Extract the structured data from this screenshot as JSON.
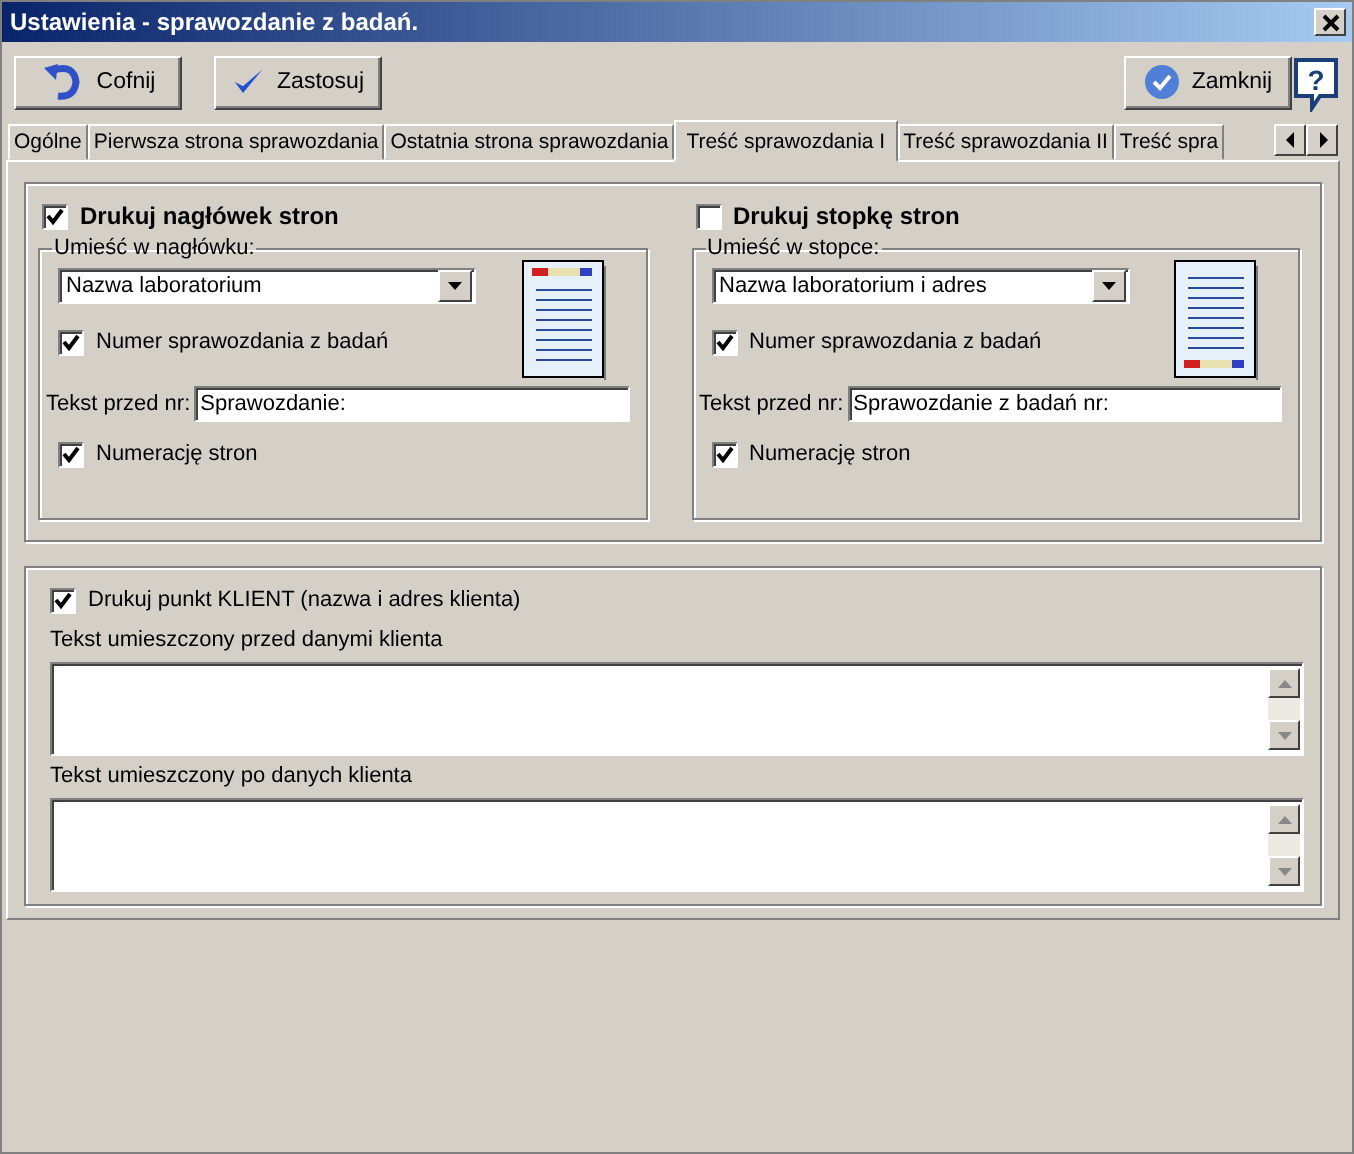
{
  "window": {
    "title": "Ustawienia - sprawozdanie z badań."
  },
  "toolbar": [
    {
      "kind": "undo",
      "label": "Cofnij"
    },
    {
      "kind": "apply",
      "label": "Zastosuj"
    }
  ],
  "close_button": {
    "label": "Zamknij"
  },
  "help_button": {
    "label": "?"
  },
  "tabs": [
    {
      "label": "Ogólne",
      "selected": false
    },
    {
      "label": "Pierwsza strona sprawozdania",
      "selected": false
    },
    {
      "label": "Ostatnia strona sprawozdania",
      "selected": false
    },
    {
      "label": "Treść sprawozdania I",
      "selected": true
    },
    {
      "label": "Treść sprawozdania II",
      "selected": false
    },
    {
      "label": "Treść spra",
      "selected": false
    }
  ],
  "sections": [
    {
      "print_label": "Drukuj nagłówek stron",
      "checked": true,
      "group_label": "Umieść w nagłówku:",
      "kind": "header",
      "dropdown": "Nazwa laboratorium",
      "number_option": {
        "label": "Numer sprawozdania z badań",
        "checked": true
      },
      "prefix_label": "Tekst przed nr:",
      "prefix_value": "Sprawozdanie:",
      "pages_option": {
        "label": "Numerację stron",
        "checked": true
      }
    },
    {
      "print_label": "Drukuj stopkę stron",
      "checked": false,
      "group_label": "Umieść w stopce:",
      "kind": "footer",
      "dropdown": "Nazwa laboratorium i adres",
      "number_option": {
        "label": "Numer sprawozdania z badań",
        "checked": true
      },
      "prefix_label": "Tekst przed nr:",
      "prefix_value": "Sprawozdanie z badań nr:",
      "pages_option": {
        "label": "Numerację stron",
        "checked": true
      }
    }
  ],
  "client": {
    "label": "Drukuj punkt KLIENT (nazwa i adres klienta)",
    "checked": true,
    "fields": [
      {
        "label": "Tekst umieszczony przed danymi klienta"
      },
      {
        "label": "Tekst umieszczony po danych klienta"
      }
    ]
  }
}
